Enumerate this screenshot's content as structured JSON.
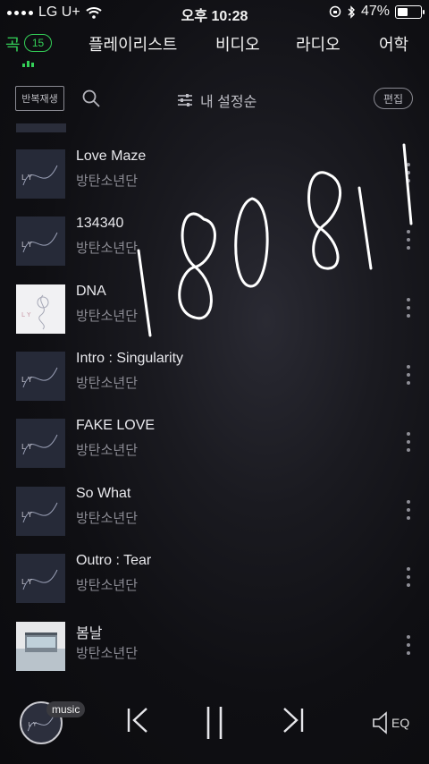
{
  "status_bar": {
    "carrier": "LG U+",
    "time": "오후 10:28",
    "battery": "47%",
    "battery_level": 0.47
  },
  "tabs": [
    {
      "label": "곡",
      "count": "15",
      "active": true
    },
    {
      "label": "플레이리스트"
    },
    {
      "label": "비디오"
    },
    {
      "label": "라디오"
    },
    {
      "label": "어학"
    }
  ],
  "toolbar": {
    "repeat_label": "반복재생",
    "sort_label": "내 설정순",
    "edit_label": "편집"
  },
  "songs": [
    {
      "title": "Love Maze",
      "artist": "방탄소년단",
      "art": "love-yourself-tear"
    },
    {
      "title": "134340",
      "artist": "방탄소년단",
      "art": "love-yourself-tear"
    },
    {
      "title": "DNA",
      "artist": "방탄소년단",
      "art": "love-yourself-her"
    },
    {
      "title": "Intro : Singularity",
      "artist": "방탄소년단",
      "art": "love-yourself-tear"
    },
    {
      "title": "FAKE LOVE",
      "artist": "방탄소년단",
      "art": "love-yourself-tear"
    },
    {
      "title": "So What",
      "artist": "방탄소년단",
      "art": "love-yourself-tear"
    },
    {
      "title": "Outro : Tear",
      "artist": "방탄소년단",
      "art": "love-yourself-tear"
    },
    {
      "title": "봄날",
      "artist": "방탄소년단",
      "art": "you-never-walk-alone"
    }
  ],
  "handwritten_note": "180811",
  "player": {
    "badge": "music",
    "eq_label": "EQ"
  },
  "colors": {
    "accent": "#34d058",
    "background": "#0f0f13",
    "secondary_text": "#8b8b93"
  }
}
